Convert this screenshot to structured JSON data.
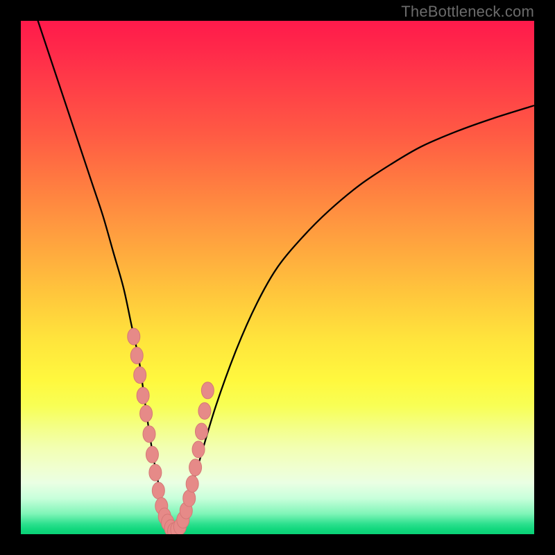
{
  "watermark": "TheBottleneck.com",
  "colors": {
    "frame": "#000000",
    "curve": "#000000",
    "marker_fill": "#e68a88",
    "marker_stroke": "#d47876",
    "gradient_top": "#ff1a4b",
    "gradient_bottom": "#0ad177"
  },
  "chart_data": {
    "type": "line",
    "title": "",
    "xlabel": "",
    "ylabel": "",
    "xlim": [
      0,
      100
    ],
    "ylim": [
      0,
      100
    ],
    "series": [
      {
        "name": "bottleneck-curve",
        "x": [
          3,
          6,
          9,
          12,
          14,
          16,
          18,
          20,
          21.5,
          23,
          24,
          25,
          26,
          27,
          28,
          29,
          30,
          31,
          32,
          33,
          35,
          38,
          42,
          46,
          50,
          55,
          60,
          66,
          72,
          78,
          85,
          92,
          100
        ],
        "y": [
          101,
          92,
          83,
          74,
          68,
          62,
          55,
          48,
          41,
          34,
          27,
          20,
          14,
          9,
          5,
          2,
          0.6,
          1.2,
          4,
          8,
          15,
          25,
          36,
          45,
          52,
          58,
          63,
          68,
          72,
          75.5,
          78.5,
          81,
          83.5
        ]
      }
    ],
    "markers": {
      "name": "highlight-points",
      "x": [
        22.0,
        22.6,
        23.2,
        23.8,
        24.4,
        25.0,
        25.6,
        26.2,
        26.8,
        27.4,
        28.0,
        28.6,
        29.2,
        29.8,
        30.4,
        31.0,
        31.6,
        32.2,
        32.8,
        33.4,
        34.0,
        34.6,
        35.2,
        35.8,
        36.4
      ],
      "y": [
        38.5,
        34.8,
        31.0,
        27.0,
        23.5,
        19.5,
        15.5,
        12.0,
        8.5,
        5.5,
        3.5,
        2.3,
        1.2,
        0.6,
        0.9,
        1.5,
        2.8,
        4.6,
        7.0,
        9.8,
        13.0,
        16.5,
        20.0,
        24.0,
        28.0
      ]
    },
    "grid": false,
    "legend": false
  }
}
